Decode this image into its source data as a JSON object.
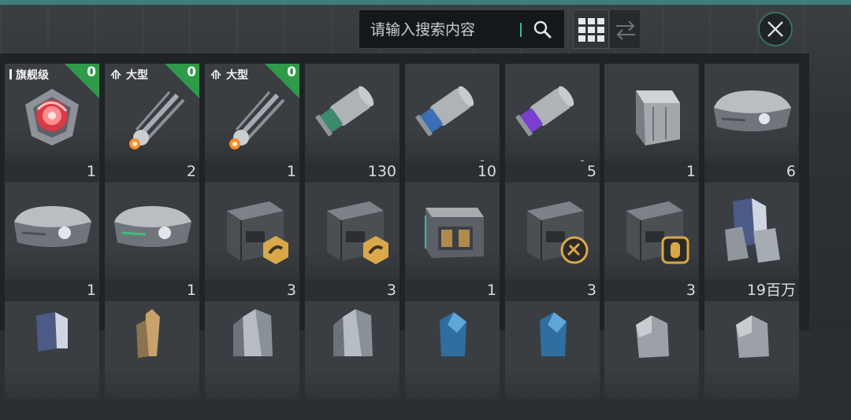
{
  "search": {
    "placeholder": "请输入搜索内容"
  },
  "items_row1": [
    {
      "tag": "旗舰级",
      "corner": "0",
      "count": "1"
    },
    {
      "tag": "大型",
      "corner": "0",
      "count": "2"
    },
    {
      "tag": "大型",
      "corner": "0",
      "count": "1"
    },
    {
      "count": "130"
    },
    {
      "count": "10"
    },
    {
      "count": "5"
    },
    {
      "count": "1"
    },
    {
      "count": "6"
    }
  ],
  "items_row2": [
    {
      "count": "1"
    },
    {
      "count": "1"
    },
    {
      "count": "3"
    },
    {
      "count": "3"
    },
    {
      "count": "1"
    },
    {
      "count": "3"
    },
    {
      "count": "3"
    },
    {
      "count": "19百万"
    }
  ],
  "colors": {
    "accent": "#3dbb8a",
    "corner_badge": "#2f9a48",
    "topbar": "#3e7f7a"
  }
}
